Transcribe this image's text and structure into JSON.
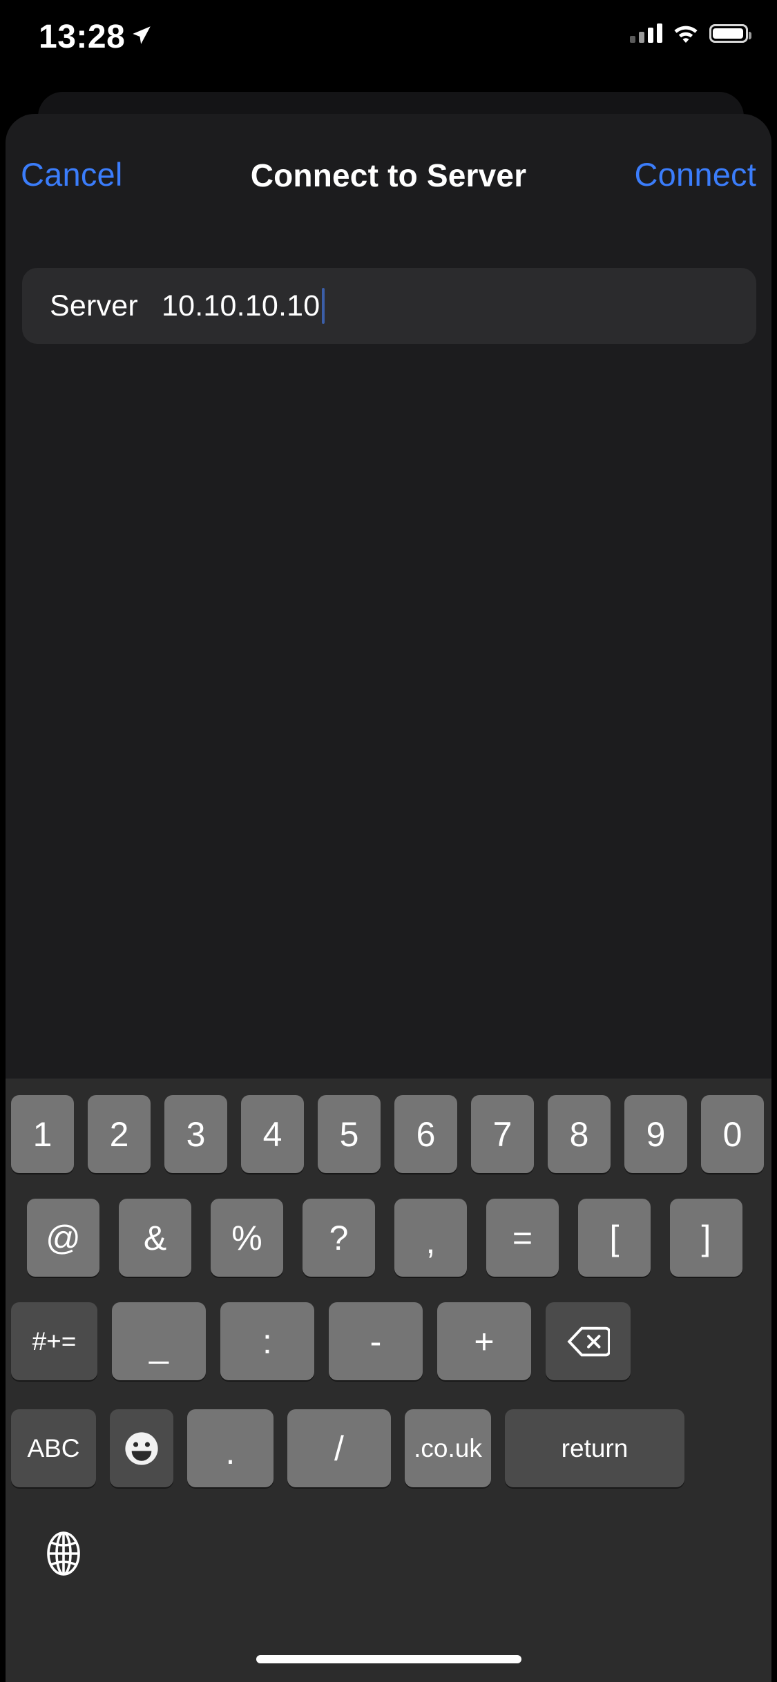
{
  "status_bar": {
    "time": "13:28",
    "location_icon": "location-arrow-icon",
    "signal_icon": "cellular-signal-icon",
    "wifi_icon": "wifi-icon",
    "battery_icon": "battery-icon",
    "battery_level_percent": 92
  },
  "nav_bar": {
    "cancel_label": "Cancel",
    "title": "Connect to Server",
    "connect_label": "Connect"
  },
  "form": {
    "server_label": "Server",
    "server_value": "10.10.10.10",
    "server_placeholder": "Server"
  },
  "keyboard": {
    "row1": [
      {
        "label": "1",
        "style": "light"
      },
      {
        "label": "2",
        "style": "light"
      },
      {
        "label": "3",
        "style": "light"
      },
      {
        "label": "4",
        "style": "light"
      },
      {
        "label": "5",
        "style": "light"
      },
      {
        "label": "6",
        "style": "light"
      },
      {
        "label": "7",
        "style": "light"
      },
      {
        "label": "8",
        "style": "light"
      },
      {
        "label": "9",
        "style": "light"
      },
      {
        "label": "0",
        "style": "light"
      }
    ],
    "row2": [
      {
        "label": "@",
        "style": "light"
      },
      {
        "label": "&",
        "style": "light"
      },
      {
        "label": "%",
        "style": "light"
      },
      {
        "label": "?",
        "style": "light"
      },
      {
        "label": ",",
        "style": "light"
      },
      {
        "label": "=",
        "style": "light"
      },
      {
        "label": "[",
        "style": "light"
      },
      {
        "label": "]",
        "style": "light"
      }
    ],
    "row3": [
      {
        "label": "#+=",
        "style": "dark"
      },
      {
        "label": "_",
        "style": "light"
      },
      {
        "label": ":",
        "style": "light"
      },
      {
        "label": "-",
        "style": "light"
      },
      {
        "label": "+",
        "style": "light"
      },
      {
        "label": "delete-icon",
        "style": "dark"
      }
    ],
    "row4": [
      {
        "label": "ABC",
        "style": "dark"
      },
      {
        "label": "emoji-icon",
        "style": "dark"
      },
      {
        "label": ".",
        "style": "light"
      },
      {
        "label": "/",
        "style": "light"
      },
      {
        "label": ".co.uk",
        "style": "light"
      },
      {
        "label": "return",
        "style": "dark"
      }
    ],
    "globe_icon": "globe-icon"
  },
  "colors": {
    "accent_blue": "#3b7dfb",
    "caret_blue": "#3b5ea8",
    "sheet_bg": "#1c1c1e",
    "field_bg": "#2b2b2d",
    "keyboard_bg": "#2c2c2c",
    "key_light": "#757575",
    "key_dark": "#4b4b4b"
  }
}
